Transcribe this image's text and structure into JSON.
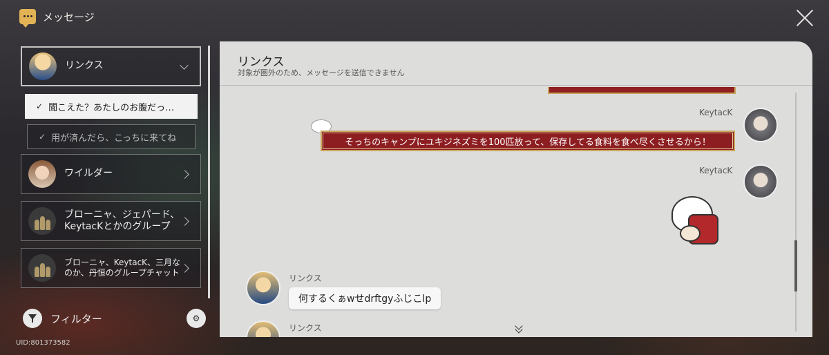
{
  "app": {
    "title": "メッセージ",
    "icon": "message-bubble-icon",
    "accent": "#e2b355"
  },
  "sidebar": {
    "items": [
      {
        "label": "リンクス",
        "avatar": "rinx-avatar",
        "chevron": "chevron-down-icon",
        "active": true
      },
      {
        "label": "ワイルダー",
        "avatar": "wilder-avatar",
        "chevron": "chevron-right-icon"
      },
      {
        "label": "ブローニャ、ジェパード、\nKeytacKとかのグループ",
        "avatar": "group-avatar",
        "chevron": "chevron-right-icon"
      },
      {
        "label": "ブローニャ、KeytacK、三月な\nのか、丹恒のグループチャット",
        "avatar": "group-avatar",
        "chevron": "chevron-right-icon"
      }
    ],
    "sub_items": [
      {
        "label": "聞こえた？あたしのお腹だっ…",
        "check": "✓",
        "selected": true
      },
      {
        "label": "用が済んだら、こっちに来てね",
        "check": "✓",
        "selected": false
      }
    ],
    "filter_label": "フィルター",
    "uid": "UID:801373582"
  },
  "chat": {
    "title": "リンクス",
    "subtitle": "対象が圏外のため、メッセージを送信できません",
    "messages": [
      {
        "sender": "KeytacK",
        "text": "そっちのキャンプにユキジネズミを100匹放って、保存してる食料を食べ尽くさせるから！",
        "style": "red-banner"
      },
      {
        "sender": "KeytacK",
        "type": "sticker"
      },
      {
        "sender": "リンクス",
        "text": "何するくぁwせdrftgyふじこlp"
      },
      {
        "sender": "リンクス"
      }
    ]
  }
}
